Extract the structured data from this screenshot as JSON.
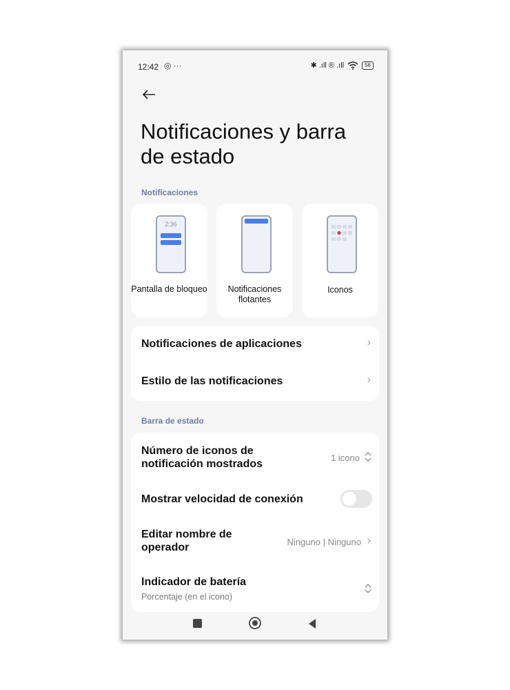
{
  "status_bar": {
    "time": "12:42",
    "left_icons": "◎ ···",
    "right_icons": "✱ .ıll ® .ıll",
    "battery": "56"
  },
  "icons": {
    "back": "arrow-left-icon",
    "chevron": "chevron-right-icon",
    "updown": "chevron-updown-icon",
    "nav_recents": "square-icon",
    "nav_home": "circle-icon",
    "nav_back": "triangle-left-icon"
  },
  "colors": {
    "accent": "#4a7de8",
    "section_label": "#6f7ca1",
    "toggle_off": "#e6e6e6"
  },
  "page": {
    "title": "Notificaciones y barra de estado"
  },
  "notifications_section": {
    "label": "Notificaciones",
    "cards": [
      {
        "label": "Pantalla de bloqueo",
        "mock_time": "2:36"
      },
      {
        "label": "Notificaciones flotantes"
      },
      {
        "label": "Iconos"
      }
    ],
    "rows": [
      {
        "label": "Notificaciones de aplicaciones",
        "chevron": "›"
      },
      {
        "label": "Estilo de las notificaciones",
        "chevron": "›"
      }
    ]
  },
  "status_section": {
    "label": "Barra de estado",
    "rows": [
      {
        "label": "Número de iconos de notificación mostrados",
        "value": "1 icono",
        "chevron": "⌃⌄"
      },
      {
        "label": "Mostrar velocidad de conexión",
        "toggle_on": false
      },
      {
        "label": "Editar nombre de operador",
        "value": "Ninguno | Ninguno",
        "chevron": "›"
      },
      {
        "label": "Indicador de batería",
        "sublabel": "Porcentaje (en el icono)",
        "chevron": "⌃⌄"
      }
    ]
  }
}
